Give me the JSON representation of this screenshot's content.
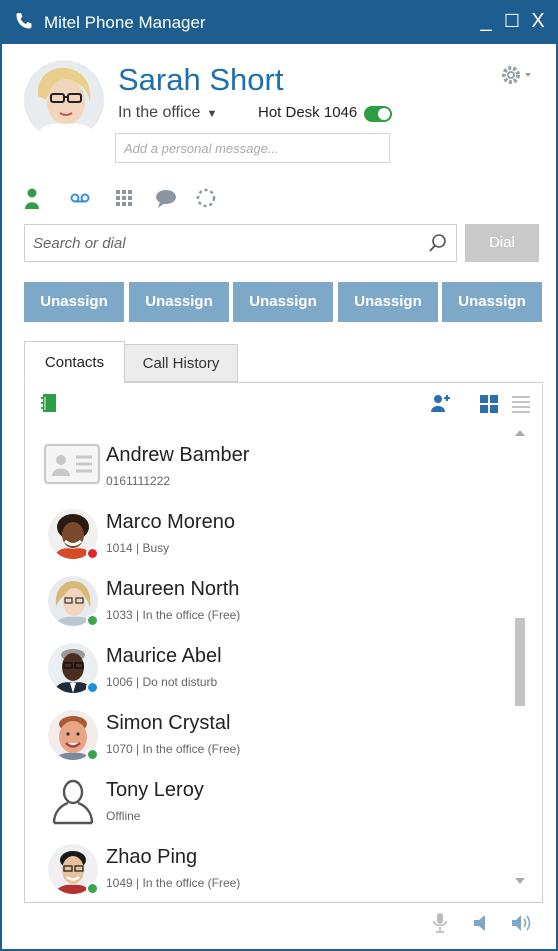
{
  "window": {
    "title": "Mitel Phone Manager",
    "minimize": "_",
    "maximize": "☐",
    "close": "X"
  },
  "profile": {
    "name": "Sarah Short",
    "presence": "In the office",
    "hotdesk": "Hot Desk 1046",
    "hotdesk_on": true,
    "message_placeholder": "Add a personal message..."
  },
  "search": {
    "placeholder": "Search or dial",
    "dial_label": "Dial"
  },
  "speed_buttons": [
    "Unassign",
    "Unassign",
    "Unassign",
    "Unassign",
    "Unassign"
  ],
  "tabs": [
    {
      "label": "Contacts",
      "active": true
    },
    {
      "label": "Call History",
      "active": false
    }
  ],
  "contacts": [
    {
      "name": "Andrew Bamber",
      "detail": "0161111222",
      "avatar": "card-icon",
      "status_color": ""
    },
    {
      "name": "Marco Moreno",
      "detail": "1014  |  Busy",
      "avatar": "photo",
      "status_color": "#e0262b"
    },
    {
      "name": "Maureen North",
      "detail": "1033  |  In the office (Free)",
      "avatar": "photo",
      "status_color": "#3aa64a"
    },
    {
      "name": "Maurice Abel",
      "detail": "1006  |  Do not disturb",
      "avatar": "photo",
      "status_color": "#1f8fd6"
    },
    {
      "name": "Simon Crystal",
      "detail": "1070  |  In the office (Free)",
      "avatar": "photo",
      "status_color": "#3aa64a"
    },
    {
      "name": "Tony Leroy",
      "detail": "Offline",
      "avatar": "person-outline-icon",
      "status_color": ""
    },
    {
      "name": "Zhao Ping",
      "detail": "1049  |  In the office (Free)",
      "avatar": "photo",
      "status_color": "#3aa64a"
    }
  ],
  "colors": {
    "titlebar": "#1d5d8f",
    "accent_blue": "#1d6fae",
    "green": "#2e9d45",
    "speed_button": "#7ea8c8"
  }
}
